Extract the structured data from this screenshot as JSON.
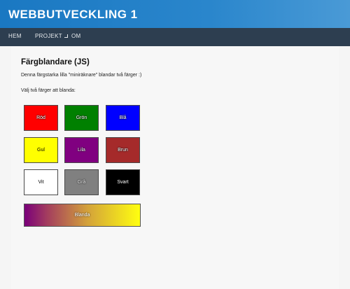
{
  "header": {
    "title": "WEBBUTVECKLING 1"
  },
  "nav": {
    "items": [
      {
        "label": "HEM"
      },
      {
        "label": "PROJEKT"
      },
      {
        "label": "OM"
      }
    ]
  },
  "main": {
    "heading": "Färgblandare (JS)",
    "intro": "Denna färgstarka lilla \"miniräknare\" blandar två färger :)",
    "prompt": "Välj två färger att blanda:",
    "swatches": [
      {
        "label": "Röd",
        "color": "#ff0000"
      },
      {
        "label": "Grön",
        "color": "#008000"
      },
      {
        "label": "Blå",
        "color": "#0000ff"
      },
      {
        "label": "Gul",
        "color": "#ffff00"
      },
      {
        "label": "Lila",
        "color": "#800080"
      },
      {
        "label": "Brun",
        "color": "#a52a2a"
      },
      {
        "label": "Vit",
        "color": "#ffffff"
      },
      {
        "label": "Grå",
        "color": "#808080"
      },
      {
        "label": "Svart",
        "color": "#000000"
      }
    ],
    "mix_button": {
      "label": "Blanda",
      "gradient_from": "#800080",
      "gradient_to": "#ffff00"
    }
  },
  "colors": {
    "header_bg": "#1a78c2",
    "nav_bg": "#2d3e50",
    "page_bg": "#f5f5f5"
  }
}
